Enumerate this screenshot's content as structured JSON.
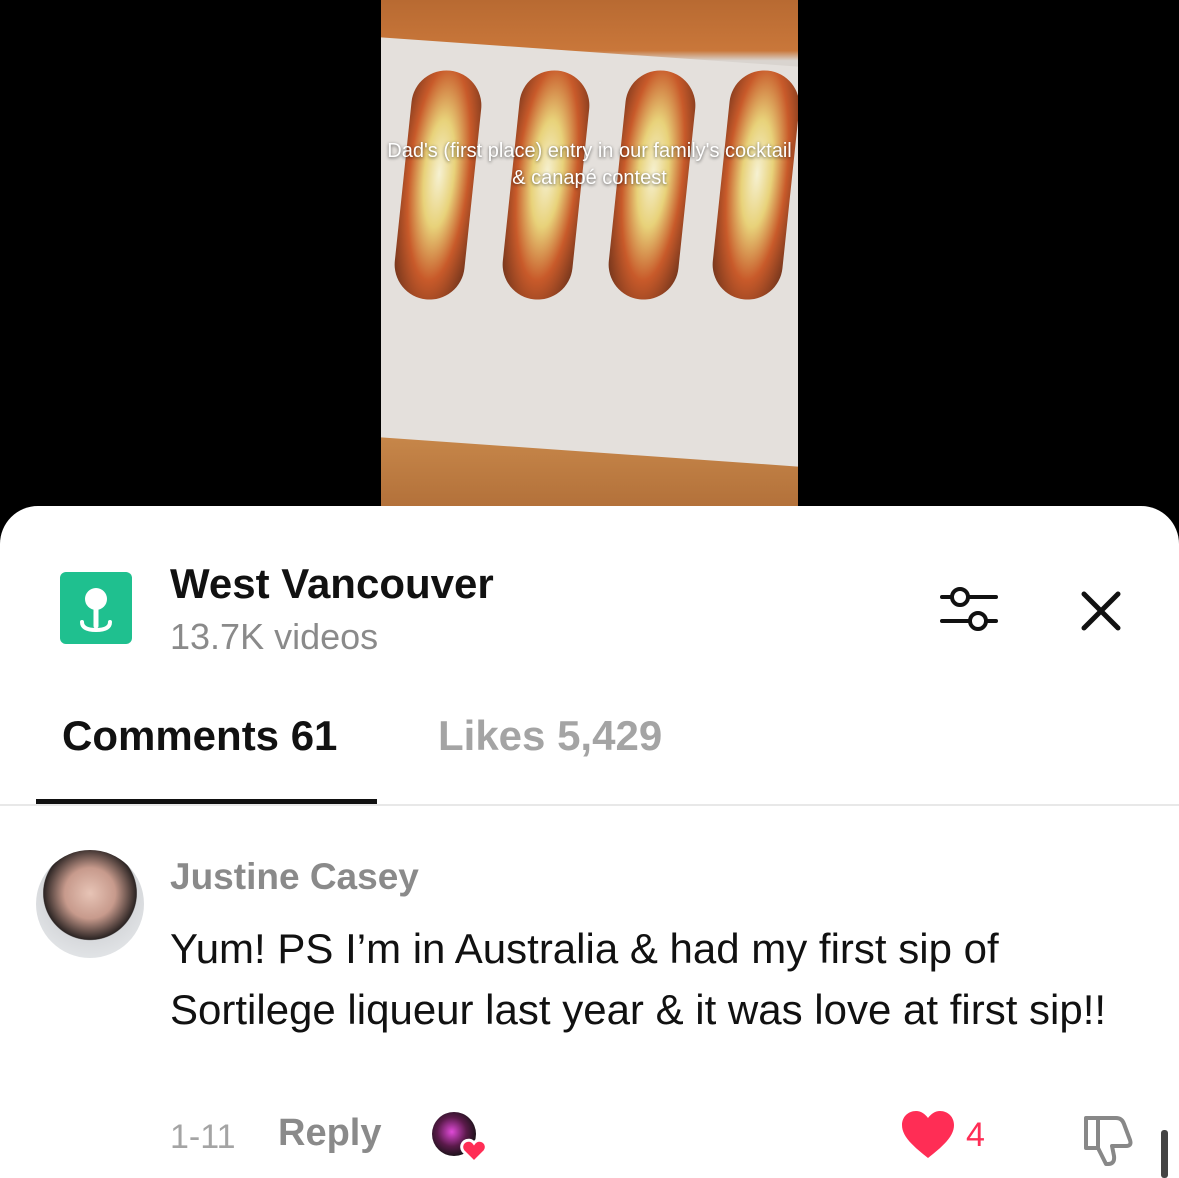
{
  "video": {
    "caption": "Dad's (first place) entry in our family's cocktail & canapé contest"
  },
  "header": {
    "location_title": "West Vancouver",
    "location_subtitle": "13.7K videos",
    "location_icon": "location-pin-icon",
    "filter_icon": "sliders-icon",
    "close_icon": "close-icon",
    "accent_color": "#1fc08f"
  },
  "tabs": {
    "comments_label": "Comments 61",
    "likes_label": "Likes 5,429"
  },
  "comment": {
    "author": "Justine Casey",
    "text": "Yum! PS I’m in Australia & had my first sip of Sortilege liqueur last year & it was love at first sip!!",
    "date": "1-11",
    "reply_label": "Reply",
    "like_count": "4",
    "like_color": "#ff2d55"
  }
}
